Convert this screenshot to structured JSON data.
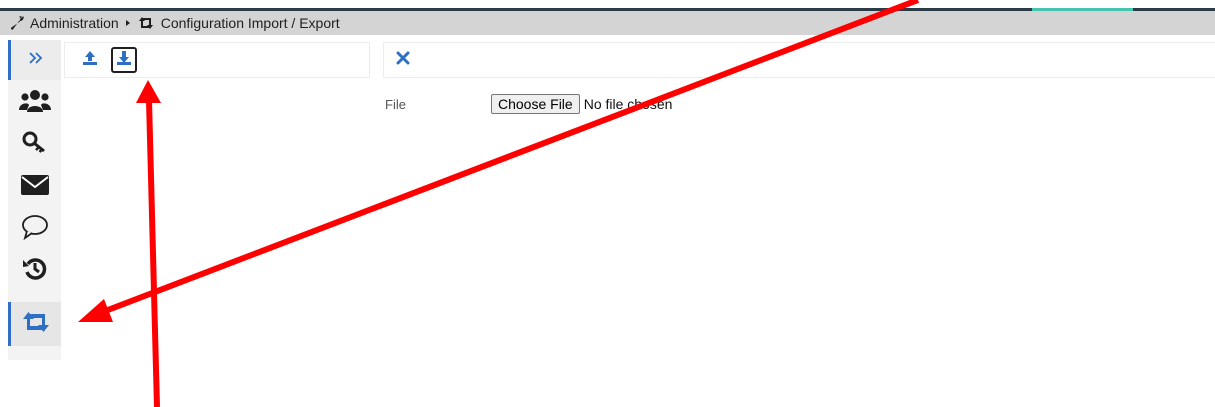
{
  "colors": {
    "accent_blue": "#2e6fc4",
    "breadcrumb_bg": "#d4d4d4",
    "top_bar": "#2b3a47",
    "top_accent": "#45c4b0",
    "annotation_red": "#ff0000"
  },
  "breadcrumb": {
    "root_icon": "wrench-icon",
    "root": "Administration",
    "current_icon": "retweet-icon",
    "current": "Configuration Import / Export"
  },
  "sidebar": {
    "items": [
      {
        "icon": "expand-icon",
        "label": "Expand"
      },
      {
        "icon": "users-icon",
        "label": "Users"
      },
      {
        "icon": "key-icon",
        "label": "Keys"
      },
      {
        "icon": "envelope-icon",
        "label": "Mail"
      },
      {
        "icon": "comment-icon",
        "label": "Messages"
      },
      {
        "icon": "history-icon",
        "label": "History"
      },
      {
        "icon": "retweet-icon",
        "label": "Configuration Import / Export",
        "active": true
      }
    ]
  },
  "toolbar": {
    "buttons": [
      {
        "icon": "upload-icon"
      },
      {
        "icon": "download-icon",
        "outlined": true
      }
    ],
    "close_icon": "close-icon"
  },
  "form": {
    "file_label": "File",
    "choose_button": "Choose File",
    "no_file_text": "No file chosen"
  }
}
